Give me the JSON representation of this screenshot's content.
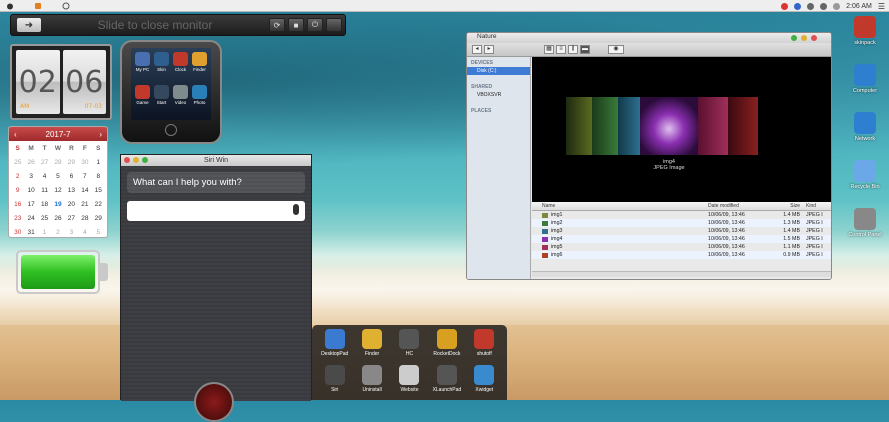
{
  "menubar": {
    "time": "2:06 AM",
    "menu_glyph": "☰"
  },
  "control_bar": {
    "slide_text": "Slide to close monitor"
  },
  "clock": {
    "hours": "02",
    "minutes": "06",
    "sub_left": "AM",
    "sub_right": "07-03"
  },
  "calendar": {
    "month": "2017-7",
    "weekdays": [
      "S",
      "M",
      "T",
      "W",
      "R",
      "F",
      "S"
    ],
    "rows": [
      [
        "25",
        "26",
        "27",
        "28",
        "29",
        "30",
        "1"
      ],
      [
        "2",
        "3",
        "4",
        "5",
        "6",
        "7",
        "8"
      ],
      [
        "9",
        "10",
        "11",
        "12",
        "13",
        "14",
        "15"
      ],
      [
        "16",
        "17",
        "18",
        "19",
        "20",
        "21",
        "22"
      ],
      [
        "23",
        "24",
        "25",
        "26",
        "27",
        "28",
        "29"
      ],
      [
        "30",
        "31",
        "1",
        "2",
        "3",
        "4",
        "5"
      ]
    ]
  },
  "iphone": {
    "apps": [
      {
        "label": "My PC",
        "color": "#4a6fb0"
      },
      {
        "label": "Skin",
        "color": "#2f5f8f"
      },
      {
        "label": "Clock",
        "color": "#c0392b"
      },
      {
        "label": "Finder",
        "color": "#e0a030"
      },
      {
        "label": "Game",
        "color": "#c0392b"
      },
      {
        "label": "Start",
        "color": "#34495e"
      },
      {
        "label": "Video",
        "color": "#7f8c8d"
      },
      {
        "label": "Photo",
        "color": "#2980b9"
      }
    ]
  },
  "siri": {
    "title": "Siri Win",
    "prompt": "What can I help you with?"
  },
  "finder": {
    "title": "Nature",
    "sidebar": {
      "devices_label": "DEVICES",
      "device_item": "Disk (C:)",
      "shared_label": "SHARED",
      "shared_item": "VBOXSVR",
      "places_label": "PLACES"
    },
    "preview_caption_name": "img4",
    "preview_caption_type": "JPEG Image",
    "columns": [
      "Name",
      "Date modified",
      "Size",
      "Kind"
    ],
    "files": [
      {
        "name": "img1",
        "date": "10/06/09, 13:46",
        "size": "1.4 MB",
        "kind": "JPEG I",
        "color": "#7a8a40"
      },
      {
        "name": "img2",
        "date": "10/06/09, 13:46",
        "size": "1.3 MB",
        "kind": "JPEG I",
        "color": "#3a7a3a"
      },
      {
        "name": "img3",
        "date": "10/06/09, 13:46",
        "size": "1.4 MB",
        "kind": "JPEG I",
        "color": "#2f6f8f"
      },
      {
        "name": "img4",
        "date": "10/06/09, 13:46",
        "size": "1.5 MB",
        "kind": "JPEG I",
        "color": "#8a2fb0"
      },
      {
        "name": "img5",
        "date": "10/06/09, 13:46",
        "size": "1.1 MB",
        "kind": "JPEG I",
        "color": "#a0305a"
      },
      {
        "name": "img6",
        "date": "10/06/09, 13:46",
        "size": "0.9 MB",
        "kind": "JPEG I",
        "color": "#b04020"
      }
    ]
  },
  "desktop_icons": [
    {
      "label": "skinpack",
      "color": "#c0392b"
    },
    {
      "label": "Computer",
      "color": "#2f7fd0"
    },
    {
      "label": "Network",
      "color": "#2f7fd0"
    },
    {
      "label": "Recycle Bin",
      "color": "#6aa8e8"
    },
    {
      "label": "Control Panel",
      "color": "#888888"
    }
  ],
  "launcher": {
    "items": [
      {
        "label": "DesktopPad",
        "color": "#3a7ad0"
      },
      {
        "label": "Finder",
        "color": "#e0b030"
      },
      {
        "label": "HC",
        "color": "#555555"
      },
      {
        "label": "RocketDock",
        "color": "#d8a020"
      },
      {
        "label": "shutoff",
        "color": "#c0392b"
      },
      {
        "label": "Siri",
        "color": "#4a4a4a"
      },
      {
        "label": "Uninstall",
        "color": "#888888"
      },
      {
        "label": "Website",
        "color": "#cccccc"
      },
      {
        "label": "XLaunchPad",
        "color": "#555555"
      },
      {
        "label": "Xwidget",
        "color": "#3a8ad0"
      }
    ]
  }
}
